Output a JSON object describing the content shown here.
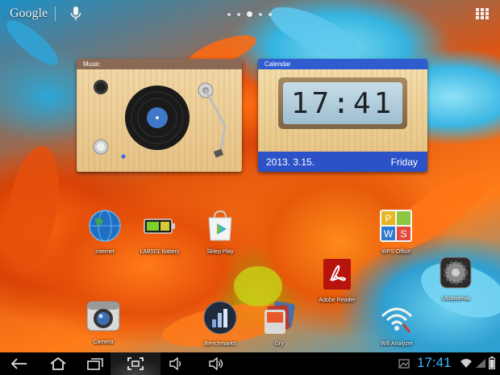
{
  "topbar": {
    "google_label": "Google",
    "page_indicator": {
      "count": 5,
      "active_index": 3
    }
  },
  "widgets": {
    "music": {
      "title": "Music"
    },
    "calendar": {
      "title": "Calendar",
      "time": "17:41",
      "date": "2013. 3.15.",
      "day": "Friday"
    }
  },
  "apps": [
    {
      "label": "Internet",
      "icon": "globe-icon"
    },
    {
      "label": "LAB501 Battery",
      "icon": "battery-icon"
    },
    {
      "label": "Sklep Play",
      "icon": "play-store-icon"
    },
    {
      "label": "WPS Office",
      "icon": "wps-office-icon"
    },
    {
      "label": "Adobe Reader",
      "icon": "adobe-reader-icon"
    },
    {
      "label": "Ustawienia",
      "icon": "settings-icon"
    },
    {
      "label": "Camera",
      "icon": "camera-icon"
    },
    {
      "label": "Benchmarks",
      "icon": "benchmarks-icon"
    },
    {
      "label": "Gry",
      "icon": "games-icon"
    },
    {
      "label": "Wifi Analyzer",
      "icon": "wifi-analyzer-icon"
    }
  ],
  "status_bar": {
    "time": "17:41"
  },
  "colors": {
    "nav_time": "#3fb6ff",
    "calendar_bar": "#2b52c6",
    "music_bar": "#8a6a54"
  }
}
